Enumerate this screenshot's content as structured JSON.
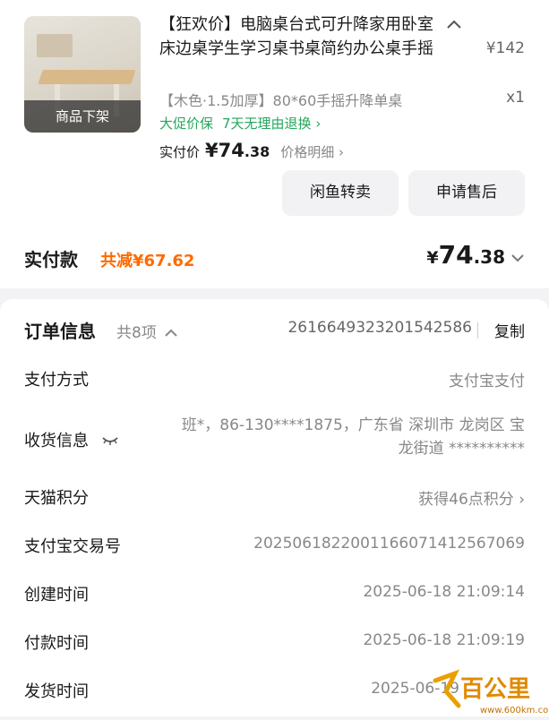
{
  "product": {
    "thumb_label": "商品下架",
    "title": "【狂欢价】电脑桌台式可升降家用卧室床边桌学生学习桌书桌简约办公桌手摇",
    "list_price": "¥142",
    "sku": "【木色·1.5加厚】80*60手摇升降单桌",
    "quantity": "x1",
    "promo1": "大促价保",
    "promo2": "7天无理由退换 ›",
    "actual_label": "实付价",
    "actual_currency": "¥",
    "actual_int": "74",
    "actual_dec": ".38",
    "price_detail": "价格明细 ›"
  },
  "buttons": {
    "resell": "闲鱼转卖",
    "after_sale": "申请售后"
  },
  "payment": {
    "label": "实付款",
    "discount": "共减¥67.62",
    "total_currency": "¥",
    "total_int": "74",
    "total_dec": ".38"
  },
  "order": {
    "title": "订单信息",
    "count": "共8项",
    "number": "2616649323201542586",
    "copy": "复制",
    "rows": [
      {
        "label": "支付方式",
        "value": "支付宝支付"
      },
      {
        "label": "收货信息",
        "value": "班*，86-130****1875，广东省 深圳市 龙岗区 宝龙街道 **********"
      },
      {
        "label": "天猫积分",
        "value": "获得46点积分 ›"
      },
      {
        "label": "支付宝交易号",
        "value": "2025061822001166071412567069"
      },
      {
        "label": "创建时间",
        "value": "2025-06-18 21:09:14"
      },
      {
        "label": "付款时间",
        "value": "2025-06-18 21:09:19"
      },
      {
        "label": "发货时间",
        "value": "2025-06-19"
      }
    ]
  },
  "watermark": {
    "text": "百公里",
    "url": "www.600km.com"
  },
  "colors": {
    "promo_green": "#26a65b",
    "discount_orange": "#ff6a00"
  }
}
